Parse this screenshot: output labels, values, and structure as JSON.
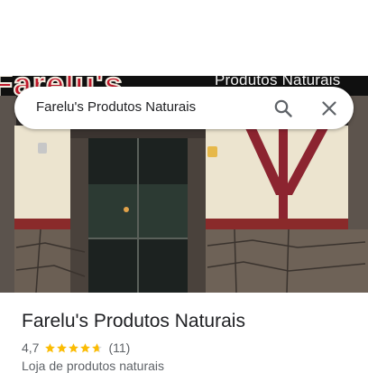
{
  "search": {
    "query": "Farelu's Produtos Naturais"
  },
  "photo": {
    "sign_brand": "Farelu's",
    "sign_tagline": "Produtos Naturais"
  },
  "place": {
    "name": "Farelu's Produtos Naturais",
    "rating": "4,7",
    "stars": 4.7,
    "reviews_count": "(11)",
    "category": "Loja de produtos naturais"
  },
  "icons": {
    "search": "search-icon",
    "close": "close-icon",
    "star": "star-icon"
  },
  "colors": {
    "star": "#fbbc04",
    "text_primary": "#202124",
    "text_secondary": "#5f6368"
  }
}
